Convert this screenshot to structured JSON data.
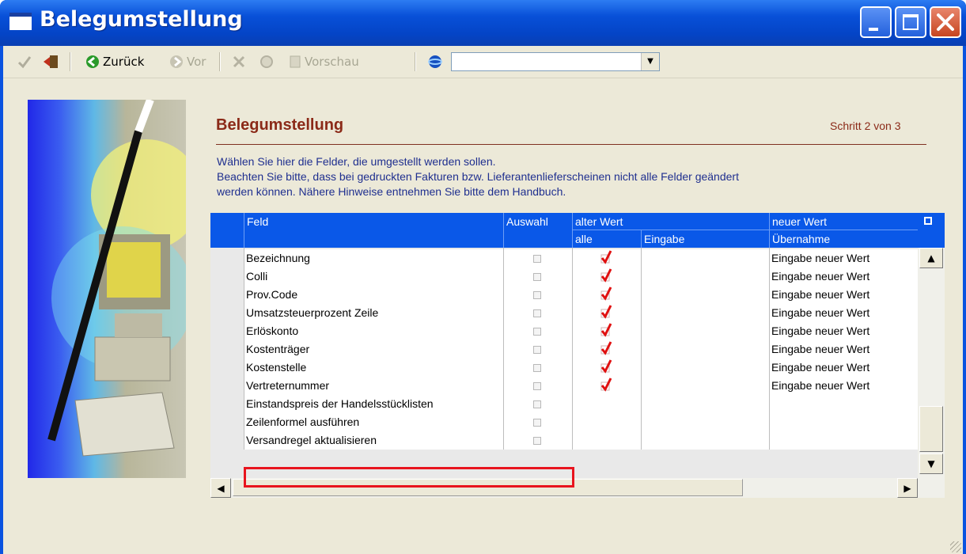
{
  "window": {
    "title": "Belegumstellung"
  },
  "toolbar": {
    "back_label": "Zurück",
    "forward_label": "Vor",
    "preview_label": "Vorschau",
    "combo_value": ""
  },
  "header": {
    "heading": "Belegumstellung",
    "step": "Schritt 2 von 3"
  },
  "description": {
    "line1": "Wählen Sie hier die Felder, die umgestellt werden sollen.",
    "line2": "Beachten Sie bitte, dass bei gedruckten Fakturen bzw. Lieferantenlieferscheinen nicht alle Felder geändert",
    "line3": "werden können. Nähere Hinweise entnehmen Sie bitte dem Handbuch."
  },
  "grid": {
    "columns": {
      "feld": "Feld",
      "auswahl": "Auswahl",
      "alter_wert": "alter Wert",
      "alle": "alle",
      "eingabe": "Eingabe",
      "neuer_wert": "neuer Wert",
      "uebernahme": "Übernahme"
    },
    "rows": [
      {
        "feld": "Bezeichnung",
        "auswahl": false,
        "alle": true,
        "uebernahme": "Eingabe neuer Wert"
      },
      {
        "feld": "Colli",
        "auswahl": false,
        "alle": true,
        "uebernahme": "Eingabe neuer Wert"
      },
      {
        "feld": "Prov.Code",
        "auswahl": false,
        "alle": true,
        "uebernahme": "Eingabe neuer Wert"
      },
      {
        "feld": "Umsatzsteuerprozent Zeile",
        "auswahl": false,
        "alle": true,
        "uebernahme": "Eingabe neuer Wert"
      },
      {
        "feld": "Erlöskonto",
        "auswahl": false,
        "alle": true,
        "uebernahme": "Eingabe neuer Wert"
      },
      {
        "feld": "Kostenträger",
        "auswahl": false,
        "alle": true,
        "uebernahme": "Eingabe neuer Wert"
      },
      {
        "feld": "Kostenstelle",
        "auswahl": false,
        "alle": true,
        "uebernahme": "Eingabe neuer Wert"
      },
      {
        "feld": "Vertreternummer",
        "auswahl": false,
        "alle": true,
        "uebernahme": "Eingabe neuer Wert"
      },
      {
        "feld": "Einstandspreis der Handelsstücklisten",
        "auswahl": false,
        "alle": false,
        "uebernahme": ""
      },
      {
        "feld": "Zeilenformel ausführen",
        "auswahl": false,
        "alle": false,
        "uebernahme": ""
      },
      {
        "feld": "Versandregel aktualisieren",
        "auswahl": false,
        "alle": false,
        "uebernahme": ""
      }
    ]
  },
  "colors": {
    "accent": "#0a58e8",
    "heading": "#8b2a18",
    "highlight": "#e8141e",
    "tick": "#e01010"
  }
}
